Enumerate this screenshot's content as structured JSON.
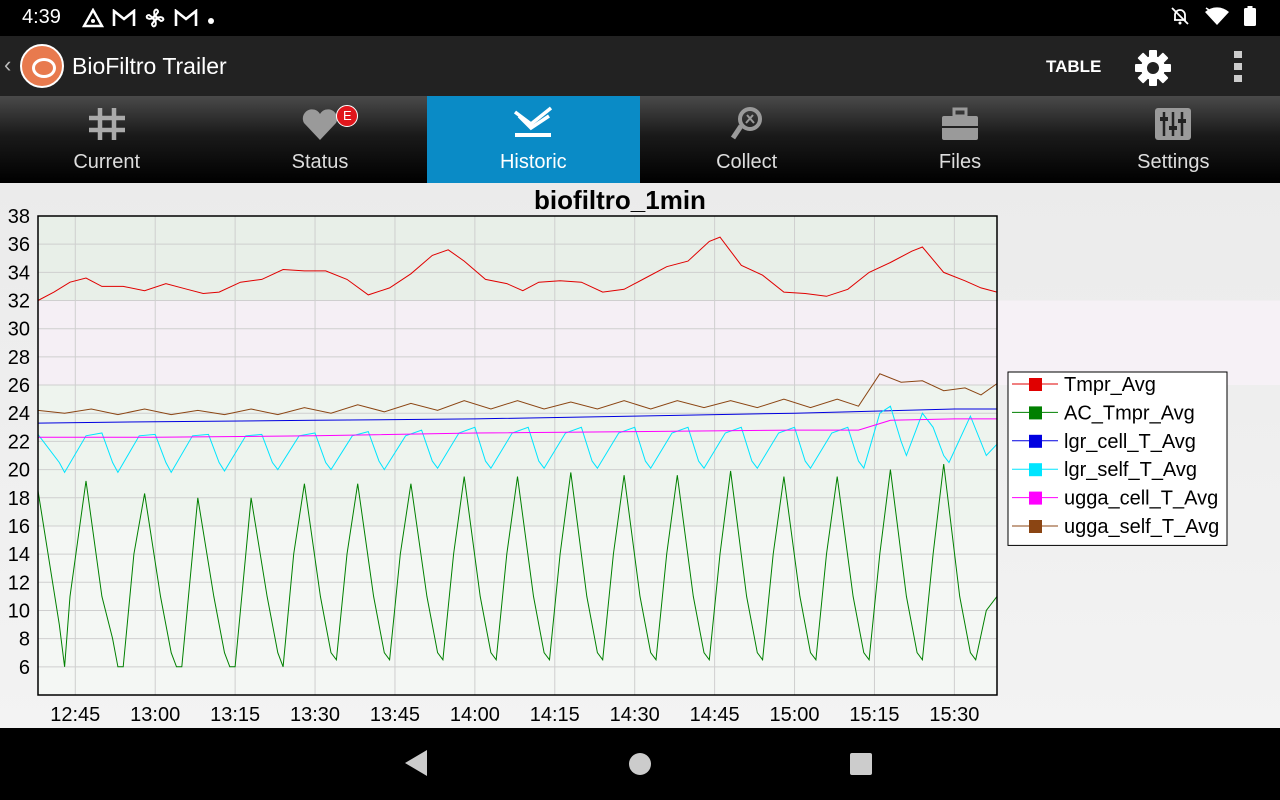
{
  "status_bar": {
    "time": "4:39",
    "left_icons": [
      "notification-app-icon",
      "gmail-icon",
      "fan-icon",
      "gmail-icon",
      "dot-icon"
    ],
    "right_icons": [
      "bell-off-icon",
      "wifi-icon",
      "battery-icon"
    ]
  },
  "app_bar": {
    "title": "BioFiltro Trailer",
    "table_label": "TABLE"
  },
  "tabs": [
    {
      "label": "Current",
      "icon": "grid-icon"
    },
    {
      "label": "Status",
      "icon": "heart-icon",
      "badge": "E"
    },
    {
      "label": "Historic",
      "icon": "historic-icon",
      "active": true
    },
    {
      "label": "Collect",
      "icon": "collect-icon"
    },
    {
      "label": "Files",
      "icon": "briefcase-icon"
    },
    {
      "label": "Settings",
      "icon": "sliders-icon"
    }
  ],
  "colors": {
    "tab_active": "#0a8bc6",
    "badge": "#e0161c"
  },
  "chart_data": {
    "type": "line",
    "title": "biofiltro_1min",
    "xlabel": "",
    "ylabel": "",
    "ylim": [
      4,
      38
    ],
    "yticks": [
      38,
      36,
      34,
      32,
      30,
      28,
      26,
      24,
      22,
      20,
      18,
      16,
      14,
      12,
      10,
      8,
      6
    ],
    "xlim": [
      "12:38",
      "15:38"
    ],
    "xticks": [
      "12:45",
      "13:00",
      "13:15",
      "13:30",
      "13:45",
      "14:00",
      "14:15",
      "14:30",
      "14:45",
      "15:00",
      "15:15",
      "15:30"
    ],
    "grid": true,
    "legend_position": "right",
    "series": [
      {
        "name": "Tmpr_Avg",
        "color": "#e00000",
        "points": [
          [
            "12:38",
            32.0
          ],
          [
            "12:41",
            32.6
          ],
          [
            "12:44",
            33.3
          ],
          [
            "12:47",
            33.6
          ],
          [
            "12:50",
            33.0
          ],
          [
            "12:54",
            33.0
          ],
          [
            "12:58",
            32.7
          ],
          [
            "13:02",
            33.2
          ],
          [
            "13:06",
            32.8
          ],
          [
            "13:09",
            32.5
          ],
          [
            "13:12",
            32.6
          ],
          [
            "13:16",
            33.3
          ],
          [
            "13:20",
            33.5
          ],
          [
            "13:24",
            34.2
          ],
          [
            "13:28",
            34.1
          ],
          [
            "13:32",
            34.1
          ],
          [
            "13:36",
            33.5
          ],
          [
            "13:40",
            32.4
          ],
          [
            "13:44",
            32.9
          ],
          [
            "13:48",
            33.9
          ],
          [
            "13:52",
            35.2
          ],
          [
            "13:55",
            35.6
          ],
          [
            "13:58",
            34.8
          ],
          [
            "14:02",
            33.5
          ],
          [
            "14:06",
            33.2
          ],
          [
            "14:09",
            32.7
          ],
          [
            "14:12",
            33.3
          ],
          [
            "14:16",
            33.4
          ],
          [
            "14:20",
            33.3
          ],
          [
            "14:24",
            32.6
          ],
          [
            "14:28",
            32.8
          ],
          [
            "14:32",
            33.6
          ],
          [
            "14:36",
            34.4
          ],
          [
            "14:40",
            34.8
          ],
          [
            "14:44",
            36.2
          ],
          [
            "14:46",
            36.5
          ],
          [
            "14:50",
            34.5
          ],
          [
            "14:54",
            33.8
          ],
          [
            "14:58",
            32.6
          ],
          [
            "15:02",
            32.5
          ],
          [
            "15:06",
            32.3
          ],
          [
            "15:10",
            32.8
          ],
          [
            "15:14",
            34.0
          ],
          [
            "15:18",
            34.7
          ],
          [
            "15:22",
            35.5
          ],
          [
            "15:24",
            35.8
          ],
          [
            "15:28",
            34.0
          ],
          [
            "15:32",
            33.4
          ],
          [
            "15:35",
            32.9
          ],
          [
            "15:38",
            32.6
          ]
        ]
      },
      {
        "name": "AC_Tmpr_Avg",
        "color": "#008000",
        "points": [
          [
            "12:38",
            18.5
          ],
          [
            "12:42",
            9.0
          ],
          [
            "12:43",
            6.0
          ],
          [
            "12:44",
            11.0
          ],
          [
            "12:47",
            19.2
          ],
          [
            "12:50",
            11.0
          ],
          [
            "12:52",
            8.0
          ],
          [
            "12:53",
            6.0
          ],
          [
            "12:54",
            6.0
          ],
          [
            "12:56",
            14.0
          ],
          [
            "12:58",
            18.3
          ],
          [
            "13:01",
            11.0
          ],
          [
            "13:03",
            7.0
          ],
          [
            "13:04",
            6.0
          ],
          [
            "13:05",
            6.0
          ],
          [
            "13:07",
            14.0
          ],
          [
            "13:08",
            18.0
          ],
          [
            "13:11",
            11.0
          ],
          [
            "13:13",
            7.0
          ],
          [
            "13:14",
            6.0
          ],
          [
            "13:15",
            6.0
          ],
          [
            "13:17",
            14.0
          ],
          [
            "13:18",
            18.0
          ],
          [
            "13:21",
            11.0
          ],
          [
            "13:23",
            7.0
          ],
          [
            "13:24",
            6.0
          ],
          [
            "13:26",
            14.0
          ],
          [
            "13:28",
            19.0
          ],
          [
            "13:31",
            11.0
          ],
          [
            "13:33",
            7.0
          ],
          [
            "13:34",
            6.5
          ],
          [
            "13:36",
            14.0
          ],
          [
            "13:38",
            19.0
          ],
          [
            "13:41",
            11.0
          ],
          [
            "13:43",
            7.0
          ],
          [
            "13:44",
            6.5
          ],
          [
            "13:46",
            14.0
          ],
          [
            "13:48",
            19.0
          ],
          [
            "13:51",
            11.0
          ],
          [
            "13:53",
            7.0
          ],
          [
            "13:54",
            6.5
          ],
          [
            "13:56",
            14.0
          ],
          [
            "13:58",
            19.5
          ],
          [
            "14:01",
            11.0
          ],
          [
            "14:03",
            7.0
          ],
          [
            "14:04",
            6.5
          ],
          [
            "14:06",
            14.0
          ],
          [
            "14:08",
            19.5
          ],
          [
            "14:11",
            11.0
          ],
          [
            "14:13",
            7.0
          ],
          [
            "14:14",
            6.5
          ],
          [
            "14:16",
            14.0
          ],
          [
            "14:18",
            19.8
          ],
          [
            "14:21",
            11.0
          ],
          [
            "14:23",
            7.0
          ],
          [
            "14:24",
            6.5
          ],
          [
            "14:26",
            14.0
          ],
          [
            "14:28",
            19.6
          ],
          [
            "14:31",
            11.0
          ],
          [
            "14:33",
            7.0
          ],
          [
            "14:34",
            6.5
          ],
          [
            "14:36",
            14.0
          ],
          [
            "14:38",
            19.6
          ],
          [
            "14:41",
            11.0
          ],
          [
            "14:43",
            7.0
          ],
          [
            "14:44",
            6.5
          ],
          [
            "14:46",
            14.0
          ],
          [
            "14:48",
            19.9
          ],
          [
            "14:51",
            11.0
          ],
          [
            "14:53",
            7.0
          ],
          [
            "14:54",
            6.5
          ],
          [
            "14:56",
            14.0
          ],
          [
            "14:58",
            19.5
          ],
          [
            "15:01",
            11.0
          ],
          [
            "15:03",
            7.0
          ],
          [
            "15:04",
            6.5
          ],
          [
            "15:06",
            14.0
          ],
          [
            "15:08",
            19.5
          ],
          [
            "15:11",
            11.0
          ],
          [
            "15:13",
            7.0
          ],
          [
            "15:14",
            6.5
          ],
          [
            "15:16",
            14.0
          ],
          [
            "15:18",
            20.0
          ],
          [
            "15:21",
            11.0
          ],
          [
            "15:23",
            7.0
          ],
          [
            "15:24",
            6.5
          ],
          [
            "15:26",
            14.0
          ],
          [
            "15:28",
            20.4
          ],
          [
            "15:31",
            11.0
          ],
          [
            "15:33",
            7.0
          ],
          [
            "15:34",
            6.5
          ],
          [
            "15:36",
            10.0
          ],
          [
            "15:38",
            11.0
          ]
        ]
      },
      {
        "name": "lgr_cell_T_Avg",
        "color": "#0000e0",
        "points": [
          [
            "12:38",
            23.3
          ],
          [
            "13:00",
            23.4
          ],
          [
            "13:30",
            23.5
          ],
          [
            "14:00",
            23.6
          ],
          [
            "14:30",
            23.8
          ],
          [
            "15:00",
            24.0
          ],
          [
            "15:30",
            24.3
          ],
          [
            "15:38",
            24.3
          ]
        ]
      },
      {
        "name": "lgr_self_T_Avg",
        "color": "#00e5ff",
        "points": [
          [
            "12:38",
            22.5
          ],
          [
            "12:42",
            20.5
          ],
          [
            "12:43",
            19.8
          ],
          [
            "12:47",
            22.4
          ],
          [
            "12:50",
            22.6
          ],
          [
            "12:52",
            20.5
          ],
          [
            "12:53",
            19.8
          ],
          [
            "12:57",
            22.4
          ],
          [
            "13:00",
            22.5
          ],
          [
            "13:02",
            20.5
          ],
          [
            "13:03",
            19.8
          ],
          [
            "13:07",
            22.4
          ],
          [
            "13:10",
            22.5
          ],
          [
            "13:12",
            20.5
          ],
          [
            "13:13",
            19.9
          ],
          [
            "13:17",
            22.4
          ],
          [
            "13:20",
            22.5
          ],
          [
            "13:22",
            20.5
          ],
          [
            "13:23",
            20.0
          ],
          [
            "13:27",
            22.4
          ],
          [
            "13:30",
            22.6
          ],
          [
            "13:32",
            20.5
          ],
          [
            "13:33",
            20.0
          ],
          [
            "13:37",
            22.4
          ],
          [
            "13:40",
            22.7
          ],
          [
            "13:42",
            20.6
          ],
          [
            "13:43",
            20.0
          ],
          [
            "13:47",
            22.4
          ],
          [
            "13:50",
            22.8
          ],
          [
            "13:52",
            20.6
          ],
          [
            "13:53",
            20.1
          ],
          [
            "13:57",
            22.6
          ],
          [
            "14:00",
            23.0
          ],
          [
            "14:02",
            20.6
          ],
          [
            "14:03",
            20.1
          ],
          [
            "14:07",
            22.6
          ],
          [
            "14:10",
            23.0
          ],
          [
            "14:12",
            20.6
          ],
          [
            "14:13",
            20.1
          ],
          [
            "14:17",
            22.6
          ],
          [
            "14:20",
            23.0
          ],
          [
            "14:22",
            20.6
          ],
          [
            "14:23",
            20.1
          ],
          [
            "14:27",
            22.6
          ],
          [
            "14:30",
            23.0
          ],
          [
            "14:32",
            20.6
          ],
          [
            "14:33",
            20.1
          ],
          [
            "14:37",
            22.6
          ],
          [
            "14:40",
            23.0
          ],
          [
            "14:42",
            20.6
          ],
          [
            "14:43",
            20.1
          ],
          [
            "14:47",
            22.6
          ],
          [
            "14:50",
            23.0
          ],
          [
            "14:52",
            20.6
          ],
          [
            "14:53",
            20.1
          ],
          [
            "14:57",
            22.6
          ],
          [
            "15:00",
            23.0
          ],
          [
            "15:02",
            20.6
          ],
          [
            "15:03",
            20.1
          ],
          [
            "15:07",
            22.6
          ],
          [
            "15:10",
            23.0
          ],
          [
            "15:12",
            20.6
          ],
          [
            "15:13",
            20.1
          ],
          [
            "15:16",
            24.0
          ],
          [
            "15:18",
            24.5
          ],
          [
            "15:20",
            22.0
          ],
          [
            "15:21",
            21.0
          ],
          [
            "15:24",
            24.0
          ],
          [
            "15:26",
            23.0
          ],
          [
            "15:28",
            21.0
          ],
          [
            "15:29",
            20.5
          ],
          [
            "15:33",
            23.8
          ],
          [
            "15:36",
            21.0
          ],
          [
            "15:38",
            21.8
          ]
        ]
      },
      {
        "name": "ugga_cell_T_Avg",
        "color": "#ff00ff",
        "points": [
          [
            "12:38",
            22.3
          ],
          [
            "13:00",
            22.3
          ],
          [
            "13:30",
            22.4
          ],
          [
            "14:00",
            22.6
          ],
          [
            "14:30",
            22.7
          ],
          [
            "15:00",
            22.8
          ],
          [
            "15:12",
            22.8
          ],
          [
            "15:18",
            23.5
          ],
          [
            "15:30",
            23.6
          ],
          [
            "15:38",
            23.6
          ]
        ]
      },
      {
        "name": "ugga_self_T_Avg",
        "color": "#8b4513",
        "points": [
          [
            "12:38",
            24.2
          ],
          [
            "12:43",
            24.0
          ],
          [
            "12:48",
            24.3
          ],
          [
            "12:53",
            23.9
          ],
          [
            "12:58",
            24.3
          ],
          [
            "13:03",
            23.9
          ],
          [
            "13:08",
            24.2
          ],
          [
            "13:13",
            23.9
          ],
          [
            "13:18",
            24.3
          ],
          [
            "13:23",
            23.9
          ],
          [
            "13:28",
            24.4
          ],
          [
            "13:33",
            24.0
          ],
          [
            "13:38",
            24.6
          ],
          [
            "13:43",
            24.1
          ],
          [
            "13:48",
            24.7
          ],
          [
            "13:53",
            24.2
          ],
          [
            "13:58",
            24.9
          ],
          [
            "14:03",
            24.3
          ],
          [
            "14:08",
            24.9
          ],
          [
            "14:13",
            24.3
          ],
          [
            "14:18",
            24.8
          ],
          [
            "14:23",
            24.3
          ],
          [
            "14:28",
            24.9
          ],
          [
            "14:33",
            24.3
          ],
          [
            "14:38",
            24.9
          ],
          [
            "14:43",
            24.4
          ],
          [
            "14:48",
            24.9
          ],
          [
            "14:53",
            24.4
          ],
          [
            "14:58",
            25.0
          ],
          [
            "15:03",
            24.4
          ],
          [
            "15:08",
            25.0
          ],
          [
            "15:12",
            24.5
          ],
          [
            "15:16",
            26.8
          ],
          [
            "15:20",
            26.2
          ],
          [
            "15:24",
            26.3
          ],
          [
            "15:28",
            25.6
          ],
          [
            "15:32",
            25.8
          ],
          [
            "15:35",
            25.3
          ],
          [
            "15:38",
            26.1
          ]
        ]
      }
    ]
  }
}
